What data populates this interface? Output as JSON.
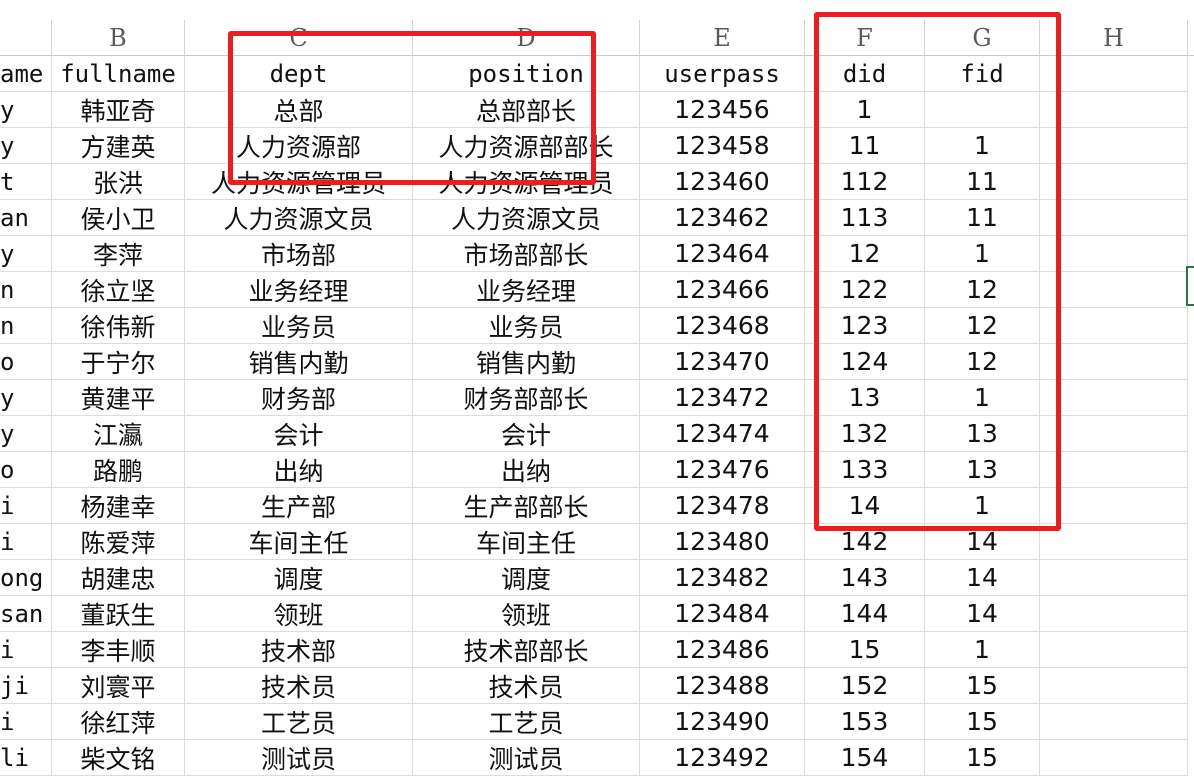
{
  "columns": [
    "B",
    "C",
    "D",
    "E",
    "F",
    "G",
    "H"
  ],
  "header_row": [
    "ame",
    "fullname",
    "dept",
    "position",
    "userpass",
    "did",
    "fid"
  ],
  "rows": [
    [
      "y",
      "韩亚奇",
      "总部",
      "总部部长",
      "123456",
      "1",
      ""
    ],
    [
      "y",
      "方建英",
      "人力资源部",
      "人力资源部部长",
      "123458",
      "11",
      "1"
    ],
    [
      "t",
      "张洪",
      "人力资源管理员",
      "人力资源管理员",
      "123460",
      "112",
      "11"
    ],
    [
      "an",
      "侯小卫",
      "人力资源文员",
      "人力资源文员",
      "123462",
      "113",
      "11"
    ],
    [
      "y",
      "李萍",
      "市场部",
      "市场部部长",
      "123464",
      "12",
      "1"
    ],
    [
      "n",
      "徐立坚",
      "业务经理",
      "业务经理",
      "123466",
      "122",
      "12"
    ],
    [
      "n",
      "徐伟新",
      "业务员",
      "业务员",
      "123468",
      "123",
      "12"
    ],
    [
      "o",
      "于宁尔",
      "销售内勤",
      "销售内勤",
      "123470",
      "124",
      "12"
    ],
    [
      "y",
      "黄建平",
      "财务部",
      "财务部部长",
      "123472",
      "13",
      "1"
    ],
    [
      "y",
      "江瀛",
      "会计",
      "会计",
      "123474",
      "132",
      "13"
    ],
    [
      "o",
      "路鹏",
      "出纳",
      "出纳",
      "123476",
      "133",
      "13"
    ],
    [
      "i",
      "杨建幸",
      "生产部",
      "生产部部长",
      "123478",
      "14",
      "1"
    ],
    [
      "i",
      "陈爱萍",
      "车间主任",
      "车间主任",
      "123480",
      "142",
      "14"
    ],
    [
      "ong",
      "胡建忠",
      "调度",
      "调度",
      "123482",
      "143",
      "14"
    ],
    [
      "san",
      "董跃生",
      "领班",
      "领班",
      "123484",
      "144",
      "14"
    ],
    [
      "i",
      "李丰顺",
      "技术部",
      "技术部部长",
      "123486",
      "15",
      "1"
    ],
    [
      "ji",
      "刘寰平",
      "技术员",
      "技术员",
      "123488",
      "152",
      "15"
    ],
    [
      "i",
      "徐红萍",
      "工艺员",
      "工艺员",
      "123490",
      "153",
      "15"
    ],
    [
      "li",
      "柴文铭",
      "测试员",
      "测试员",
      "123492",
      "154",
      "15"
    ]
  ],
  "colors": {
    "highlight": "#ee1c1c",
    "selection": "#1f7a3a"
  }
}
